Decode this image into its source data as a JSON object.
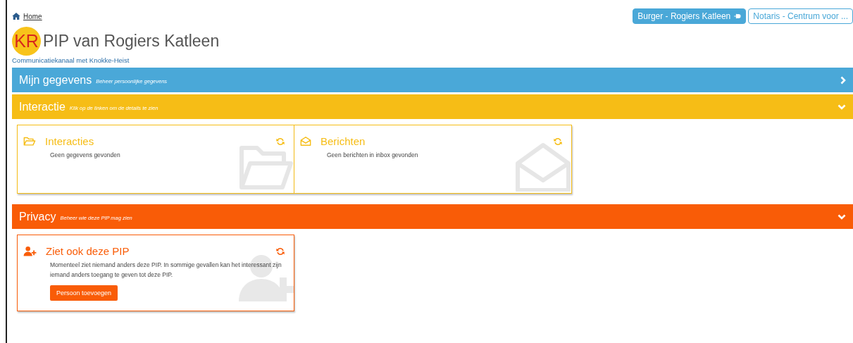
{
  "breadcrumb": {
    "label": "Home"
  },
  "roles": [
    {
      "label": "Burger - Rogiers Katleen",
      "selected": true
    },
    {
      "label": "Notaris - Centrum voor ...",
      "selected": false
    }
  ],
  "header": {
    "initials": "KR",
    "title": "PIP van Rogiers Katleen",
    "subtitle": "Communicatiekanaal met Knokke-Heist"
  },
  "sections": [
    {
      "title": "Mijn gegevens",
      "subtitle": "Beheer persoonlijke gegevens",
      "color": "#4aa8d8",
      "expanded": false
    },
    {
      "title": "Interactie",
      "subtitle": "Klik op de linken om de details te zien",
      "color": "#f6bd16",
      "expanded": true,
      "cards": [
        {
          "kind": "folder",
          "title": "Interacties",
          "text": "Geen gegevens gevonden"
        },
        {
          "kind": "mail",
          "title": "Berichten",
          "text": "Geen berichten in inbox gevonden"
        }
      ]
    },
    {
      "title": "Privacy",
      "subtitle": "Beheer wie deze PIP mag zien",
      "color": "#f95c07",
      "expanded": true,
      "cards": [
        {
          "kind": "person",
          "title": "Ziet ook deze PIP",
          "text": "Momenteel ziet niemand anders deze PIP. In sommige gevallen kan het interessant zijn iemand anders toegang te geven tot deze PIP.",
          "button": "Persoon toevoegen"
        }
      ]
    }
  ]
}
